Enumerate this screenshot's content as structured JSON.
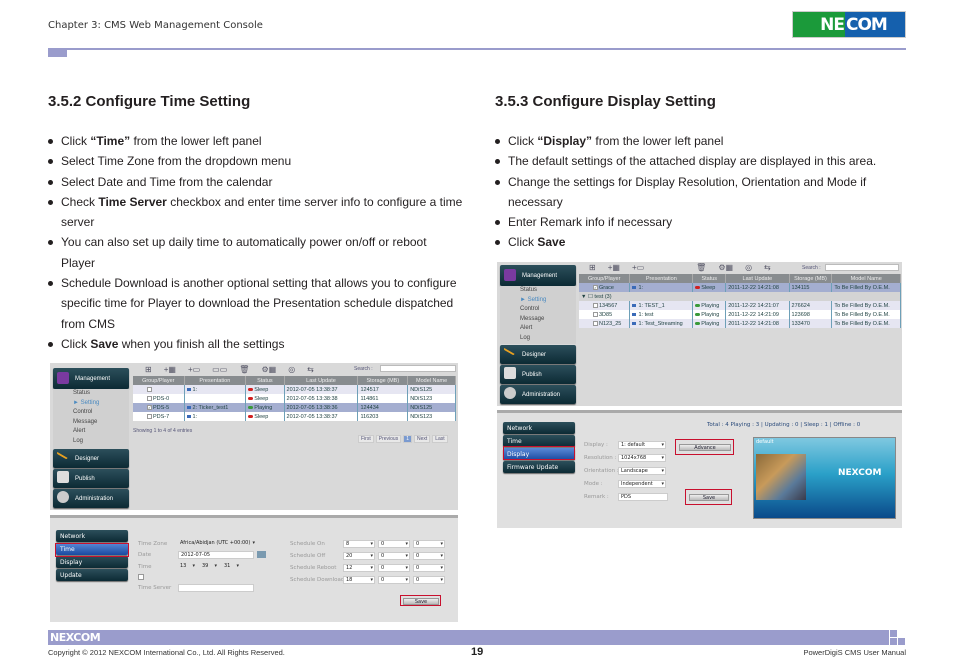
{
  "header": {
    "chapter": "Chapter 3: CMS Web Management Console",
    "logo_left": "NE",
    "logo_right": "COM"
  },
  "left": {
    "title": "3.5.2 Configure Time Setting",
    "bullets": [
      {
        "pre": "Click ",
        "bold": "“Time”",
        "post": " from the lower left panel"
      },
      {
        "pre": "Select Time Zone from the dropdown menu",
        "bold": "",
        "post": ""
      },
      {
        "pre": "Select Date and Time from the calendar",
        "bold": "",
        "post": ""
      },
      {
        "pre": "Check ",
        "bold": "Time Server",
        "post": " checkbox and enter time server info to configure a time server"
      },
      {
        "pre": "You can also set up daily time to automatically power on/off or reboot Player",
        "bold": "",
        "post": ""
      },
      {
        "pre": "Schedule Download is another optional setting that allows you to configure specific time for Player to download the Presentation schedule dispatched from CMS",
        "bold": "",
        "post": ""
      },
      {
        "pre": "Click ",
        "bold": "Save",
        "post": " when you finish all the settings"
      }
    ],
    "shot": {
      "nav": {
        "management": "Management",
        "menu": [
          "Status",
          "► Setting",
          "Control",
          "Message",
          "Alert",
          "Log"
        ],
        "designer": "Designer",
        "publish": "Publish",
        "administration": "Administration"
      },
      "toolbar_icons": [
        "group-icon",
        "add-group-icon",
        "add-player-icon",
        "link-icon",
        "trash-icon",
        "settings-group-icon",
        "view-icon",
        "sync-icon"
      ],
      "search_label": "Search :",
      "columns": [
        "Group/Player",
        "Presentation",
        "Status",
        "Last Update",
        "Storage (MB)",
        "Model Name"
      ],
      "rows": [
        {
          "player": "",
          "presentation": "1:",
          "status": "Sleep",
          "last_update": "2012-07-05 13:38:37",
          "storage": "124517",
          "model": "NDiS125",
          "checked": false
        },
        {
          "player": "PDS-0",
          "presentation": "",
          "status": "Sleep",
          "last_update": "2012-07-05 13:38:38",
          "storage": "114861",
          "model": "NDiS123",
          "checked": false
        },
        {
          "player": "PDS-5",
          "presentation": "2: Ticker_test1",
          "status": "Playing",
          "last_update": "2012-07-05 13:38:36",
          "storage": "124434",
          "model": "NDiS125",
          "checked": true
        },
        {
          "player": "PDS-7",
          "presentation": "1:",
          "status": "Sleep",
          "last_update": "2012-07-05 13:38:37",
          "storage": "116203",
          "model": "NDiS123",
          "checked": false
        }
      ],
      "showing": "Showing 1 to 4 of 4 entries",
      "pager": [
        "First",
        "Previous",
        "1",
        "Next",
        "Last"
      ],
      "lower_nav": [
        "Network",
        "Time",
        "Display",
        "Update"
      ],
      "form": {
        "time_zone_label": "Time Zone",
        "time_zone_value": "Africa/Abidjan (UTC +00:00)",
        "date_label": "Date",
        "date_value": "2012-07-05",
        "time_label": "Time",
        "time_h": "13",
        "time_m": "39",
        "time_s": "31",
        "time_server_label": "Time Server",
        "time_server_value": "",
        "schedules": [
          {
            "label": "Schedule On",
            "v": [
              "8",
              "0",
              "0"
            ]
          },
          {
            "label": "Schedule Off",
            "v": [
              "20",
              "0",
              "0"
            ]
          },
          {
            "label": "Schedule Reboot",
            "v": [
              "12",
              "0",
              "0"
            ]
          },
          {
            "label": "Schedule Download",
            "v": [
              "18",
              "0",
              "0"
            ]
          }
        ],
        "save": "Save"
      }
    }
  },
  "right": {
    "title": "3.5.3 Configure Display Setting",
    "bullets": [
      {
        "pre": "Click ",
        "bold": "“Display”",
        "post": " from the lower left panel"
      },
      {
        "pre": "The default settings of the attached display are displayed in this area.",
        "bold": "",
        "post": ""
      },
      {
        "pre": "Change the settings for Display Resolution, Orientation and Mode if necessary",
        "bold": "",
        "post": ""
      },
      {
        "pre": "Enter Remark info if necessary",
        "bold": "",
        "post": ""
      },
      {
        "pre": "Click ",
        "bold": "Save",
        "post": ""
      }
    ],
    "shot": {
      "nav": {
        "management": "Management",
        "menu": [
          "Status",
          "► Setting",
          "Control",
          "Message",
          "Alert",
          "Log"
        ],
        "designer": "Designer",
        "publish": "Publish",
        "administration": "Administration"
      },
      "search_label": "Search :",
      "columns": [
        "Group/Player",
        "Presentation",
        "Status",
        "Last Update",
        "Storage (MB)",
        "Model Name"
      ],
      "rows": [
        {
          "player": "Grace",
          "presentation": "1:",
          "status": "Sleep",
          "last_update": "2011-12-22 14:21:08",
          "storage": "134115",
          "model": "To Be Filled By O.E.M.",
          "checked": true
        },
        {
          "player": "test (3)",
          "group": true
        },
        {
          "player": "134567",
          "presentation": "1: TEST_1",
          "status": "Playing",
          "last_update": "2011-12-22 14:21:07",
          "storage": "276624",
          "model": "To Be Filled By O.E.M.",
          "checked": false
        },
        {
          "player": "3D85",
          "presentation": "1: test",
          "status": "Playing",
          "last_update": "2011-12-22 14:21:09",
          "storage": "123698",
          "model": "To Be Filled By O.E.M.",
          "checked": false
        },
        {
          "player": "N123_25",
          "presentation": "1: Test_Streaming",
          "status": "Playing",
          "last_update": "2011-12-22 14:21:08",
          "storage": "133470",
          "model": "To Be Filled By O.E.M.",
          "checked": false
        }
      ],
      "lower_nav": [
        "Network",
        "Time",
        "Display",
        "Firmware Update"
      ],
      "summary": "Total : 4   Playing : 3  |  Updating : 0  |  Sleep : 1  |  Offline : 0",
      "form": {
        "display_label": "Display :",
        "display_value": "1: default",
        "resolution_label": "Resolution :",
        "resolution_value": "1024x768",
        "orientation_label": "Orientation :",
        "orientation_value": "Landscape",
        "mode_label": "Mode :",
        "mode_value": "Independent",
        "remark_label": "Remark :",
        "remark_value": "PDS",
        "advance": "Advance",
        "save": "Save"
      },
      "preview_label": "default",
      "preview_brand": "NEXCOM"
    }
  },
  "footer": {
    "logo": "NEXCOM",
    "copyright": "Copyright © 2012 NEXCOM International Co., Ltd. All Rights Reserved.",
    "page": "19",
    "manual": "PowerDigiS CMS User Manual"
  }
}
